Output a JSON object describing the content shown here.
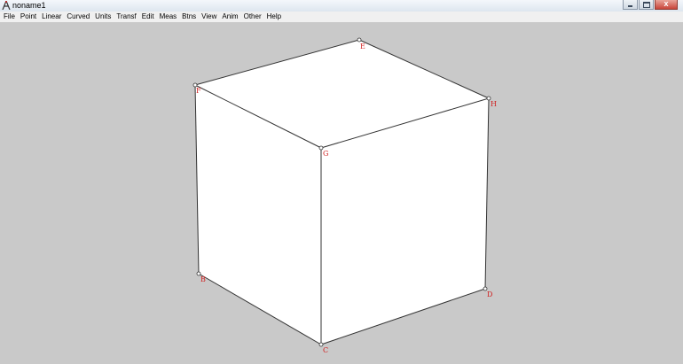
{
  "window": {
    "title": "noname1",
    "close_glyph": "x",
    "icon": "compass-icon"
  },
  "menu": [
    "File",
    "Point",
    "Linear",
    "Curved",
    "Units",
    "Transf",
    "Edit",
    "Meas",
    "Btns",
    "View",
    "Anim",
    "Other",
    "Help"
  ],
  "figure": {
    "points": [
      "E",
      "F",
      "G",
      "H",
      "B",
      "C",
      "D"
    ],
    "colors": {
      "background": "#c9c9c9",
      "face": "#ffffff",
      "edge": "#333333",
      "label": "#d02020"
    }
  }
}
